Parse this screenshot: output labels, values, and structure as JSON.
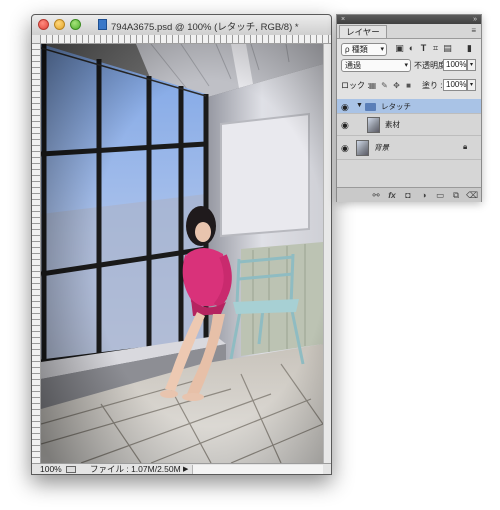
{
  "document": {
    "title": "794A3675.psd @ 100% (レタッチ, RGB/8) *",
    "zoom": "100%",
    "file_info": "ファイル : 1.07M/2.50M",
    "status_arrow": "▶"
  },
  "layers_panel": {
    "tab_label": "レイヤー",
    "menu_icon": "≡",
    "collapse_icon": "»",
    "close_icon": "×",
    "filter_kind": "ρ 種類",
    "blend_mode": "通過",
    "opacity_label": "不透明度 :",
    "opacity_value": "100%",
    "lock_label": "ロック :",
    "fill_label": "塗り :",
    "fill_value": "100%",
    "layers": [
      {
        "name": "レタッチ",
        "type": "group",
        "visible": true,
        "selected": true
      },
      {
        "name": "素材",
        "type": "layer",
        "visible": true,
        "selected": false
      },
      {
        "name": "背景",
        "type": "background",
        "visible": true,
        "selected": false,
        "locked": true
      }
    ],
    "filter_icons": [
      "image-filter-icon",
      "adjustment-filter-icon",
      "type-filter-icon",
      "shape-filter-icon",
      "smart-object-filter-icon",
      "filter-toggle-icon"
    ],
    "lock_icons": [
      "lock-transparent-icon",
      "lock-image-icon",
      "lock-position-icon",
      "lock-all-icon"
    ],
    "footer_icons": [
      "link-icon",
      "fx-icon",
      "mask-icon",
      "adjustment-icon",
      "group-icon",
      "new-layer-icon",
      "trash-icon"
    ]
  },
  "colors": {
    "selection": "#a9c3e6",
    "shirt": "#d9327a"
  }
}
